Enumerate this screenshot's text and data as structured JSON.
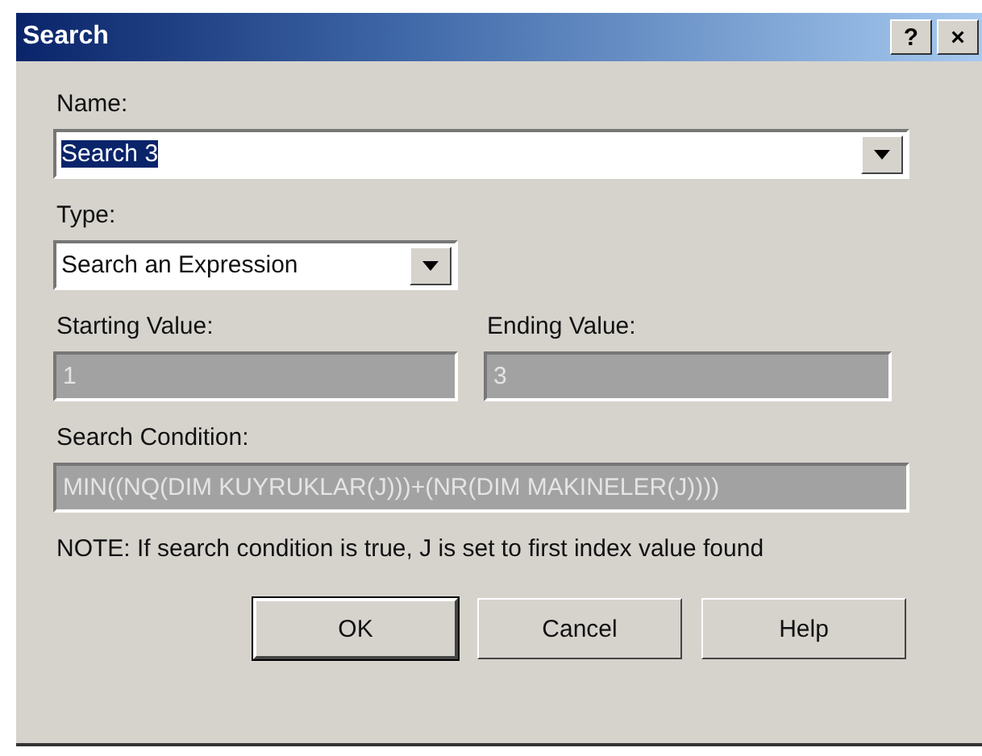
{
  "window": {
    "title": "Search",
    "title_buttons": [
      "?",
      "×"
    ]
  },
  "name": {
    "label": "Name:",
    "value": "Search 3",
    "selected": true
  },
  "type": {
    "label": "Type:",
    "value": "Search an Expression"
  },
  "starting_value": {
    "label": "Starting Value:",
    "value": "1",
    "disabled": true
  },
  "ending_value": {
    "label": "Ending Value:",
    "value": "3",
    "disabled": true
  },
  "search_condition": {
    "label": "Search Condition:",
    "value": "MIN((NQ(DIM KUYRUKLAR(J)))+(NR(DIM MAKINELER(J))))",
    "disabled": true
  },
  "note": "NOTE: If search condition is true, J is set to first index value found",
  "buttons": [
    {
      "label": "OK",
      "default": true
    },
    {
      "label": "Cancel",
      "default": false
    },
    {
      "label": "Help",
      "default": false
    }
  ]
}
